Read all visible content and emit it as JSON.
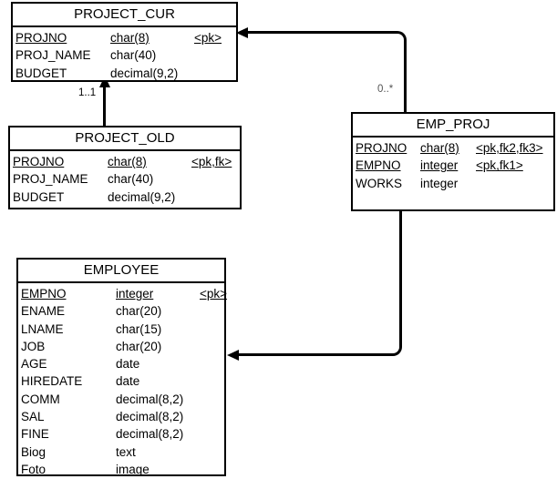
{
  "diagram": {
    "type": "entity-relationship-diagram",
    "background_color": "#ffffff",
    "line_color": "#000000"
  },
  "entities": [
    {
      "name": "PROJECT_CUR",
      "attributes": [
        {
          "name": "PROJNO",
          "type": "char(8)",
          "key": "<pk>",
          "is_key": true
        },
        {
          "name": "PROJ_NAME",
          "type": "char(40)",
          "key": "",
          "is_key": false
        },
        {
          "name": "BUDGET",
          "type": "decimal(9,2)",
          "key": "",
          "is_key": false
        }
      ]
    },
    {
      "name": "PROJECT_OLD",
      "attributes": [
        {
          "name": "PROJNO",
          "type": "char(8)",
          "key": "<pk,fk>",
          "is_key": true
        },
        {
          "name": "PROJ_NAME",
          "type": "char(40)",
          "key": "",
          "is_key": false
        },
        {
          "name": "BUDGET",
          "type": "decimal(9,2)",
          "key": "",
          "is_key": false
        }
      ]
    },
    {
      "name": "EMP_PROJ",
      "attributes": [
        {
          "name": "PROJNO",
          "type": "char(8)",
          "key": "<pk,fk2,fk3>",
          "is_key": true
        },
        {
          "name": "EMPNO",
          "type": "integer",
          "key": "<pk,fk1>",
          "is_key": true
        },
        {
          "name": "WORKS",
          "type": "integer",
          "key": "",
          "is_key": false
        }
      ]
    },
    {
      "name": "EMPLOYEE",
      "attributes": [
        {
          "name": "EMPNO",
          "type": "integer",
          "key": "<pk>",
          "is_key": true
        },
        {
          "name": "ENAME",
          "type": "char(20)",
          "key": "",
          "is_key": false
        },
        {
          "name": "LNAME",
          "type": "char(15)",
          "key": "",
          "is_key": false
        },
        {
          "name": "JOB",
          "type": "char(20)",
          "key": "",
          "is_key": false
        },
        {
          "name": "AGE",
          "type": "date",
          "key": "",
          "is_key": false
        },
        {
          "name": "HIREDATE",
          "type": "date",
          "key": "",
          "is_key": false
        },
        {
          "name": "COMM",
          "type": "decimal(8,2)",
          "key": "",
          "is_key": false
        },
        {
          "name": "SAL",
          "type": "decimal(8,2)",
          "key": "",
          "is_key": false
        },
        {
          "name": "FINE",
          "type": "decimal(8,2)",
          "key": "",
          "is_key": false
        },
        {
          "name": "Biog",
          "type": "text",
          "key": "",
          "is_key": false
        },
        {
          "name": "Foto",
          "type": "image",
          "key": "",
          "is_key": false
        }
      ]
    }
  ],
  "relationships": [
    {
      "from": "PROJECT_OLD",
      "to": "PROJECT_CUR",
      "cardinality": "1..1"
    },
    {
      "from": "EMP_PROJ",
      "to": "PROJECT_CUR",
      "cardinality": "0..*"
    },
    {
      "from": "EMP_PROJ",
      "to": "EMPLOYEE",
      "cardinality": ""
    }
  ]
}
